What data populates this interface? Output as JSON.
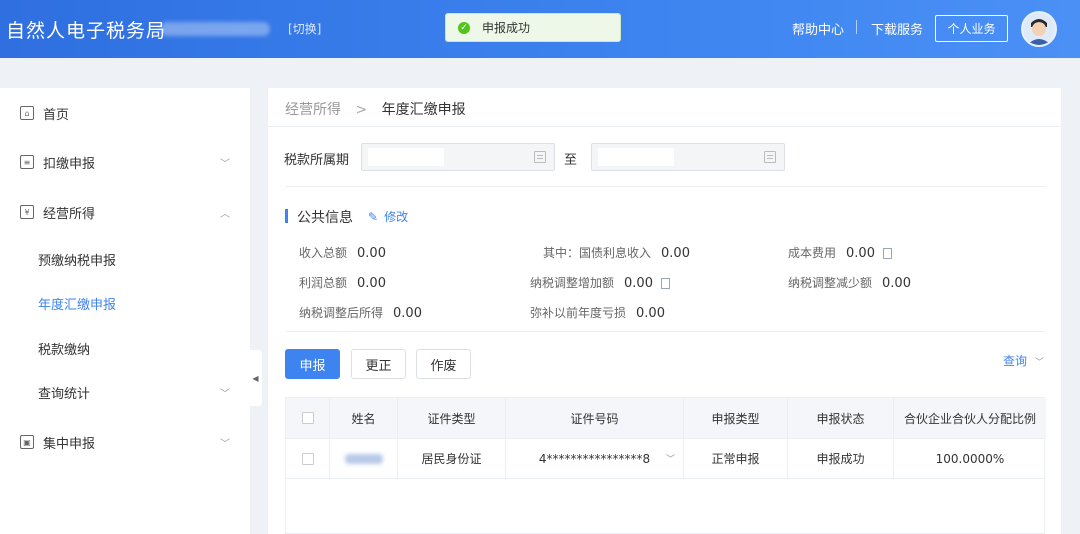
{
  "header": {
    "app_title": "自然人电子税务局",
    "switch_label": "[切换]",
    "toast_text": "申报成功",
    "help_label": "帮助中心",
    "download_label": "下载服务",
    "business_label": "个人业务",
    "brand_color": "#3d84f0"
  },
  "sidebar": {
    "items": [
      {
        "label": "首页",
        "icon": "home-icon"
      },
      {
        "label": "扣缴申报",
        "icon": "report-icon"
      },
      {
        "label": "经营所得",
        "icon": "business-icon"
      },
      {
        "label": "集中申报",
        "icon": "batch-icon"
      }
    ],
    "sub_items": [
      {
        "label": "预缴纳税申报"
      },
      {
        "label": "年度汇缴申报",
        "active": true
      },
      {
        "label": "税款缴纳"
      },
      {
        "label": "查询统计"
      }
    ]
  },
  "breadcrumb": {
    "parent": "经营所得",
    "separator": ">",
    "current": "年度汇缴申报"
  },
  "filters": {
    "period_label": "税款所属期",
    "to_label": "至"
  },
  "public_info": {
    "title": "公共信息",
    "edit_label": "修改",
    "fields": [
      {
        "label": "收入总额",
        "value": "0.00"
      },
      {
        "label": "其中：国债利息收入",
        "value": "0.00"
      },
      {
        "label": "成本费用",
        "value": "0.00"
      },
      {
        "label": "利润总额",
        "value": "0.00"
      },
      {
        "label": "纳税调整增加额",
        "value": "0.00"
      },
      {
        "label": "纳税调整减少额",
        "value": "0.00"
      },
      {
        "label": "纳税调整后所得",
        "value": "0.00"
      },
      {
        "label": "弥补以前年度亏损",
        "value": "0.00"
      }
    ]
  },
  "actions": {
    "declare_label": "申报",
    "correct_label": "更正",
    "void_label": "作废",
    "query_label": "查询"
  },
  "table": {
    "headers": [
      "姓名",
      "证件类型",
      "证件号码",
      "申报类型",
      "申报状态",
      "合伙企业合伙人分配比例"
    ],
    "rows": [
      {
        "id_type": "居民身份证",
        "id_number": "4****************8",
        "declare_type": "正常申报",
        "status": "申报成功",
        "ratio": "100.0000%"
      }
    ]
  }
}
